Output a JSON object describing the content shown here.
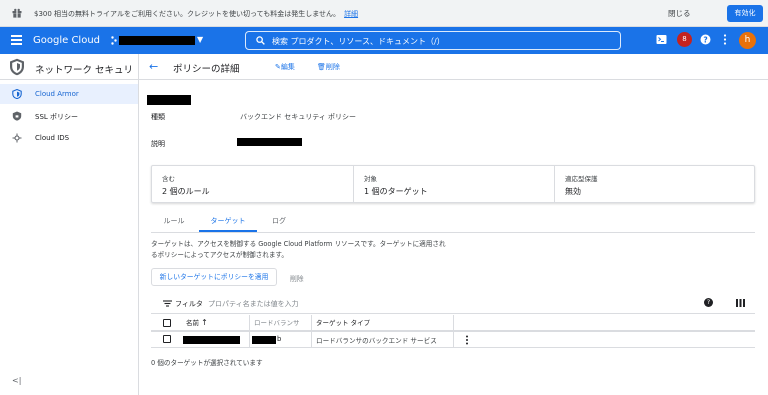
{
  "promo": {
    "text": "$300 相当の無料トライアルをご利用ください。クレジットを使い切っても料金は発生しません。",
    "link": "詳細",
    "dismiss": "閉じる",
    "activate": "有効化"
  },
  "header": {
    "brand": "Google Cloud",
    "search_label": "検索  プロダクト、リソース、ドキュメント（/）",
    "notification_count": "8",
    "avatar_letter": "h"
  },
  "sidebar": {
    "title": "ネットワーク セキュリティ",
    "items": [
      {
        "label": "Cloud Armor",
        "icon": "shield-icon"
      },
      {
        "label": "SSL ポリシー",
        "icon": "ssl-shield-icon"
      },
      {
        "label": "Cloud IDS",
        "icon": "ids-icon"
      }
    ],
    "collapse": "<|"
  },
  "main": {
    "title": "ポリシーの詳細",
    "edit": "編集",
    "delete": "削除",
    "type_key": "種類",
    "type_value": "バックエンド セキュリティ ポリシー",
    "desc_key": "説明",
    "summary": [
      {
        "key": "含む",
        "value": "2 個のルール"
      },
      {
        "key": "対象",
        "value": "1 個のターゲット"
      },
      {
        "key": "適応型保護",
        "value": "無効"
      }
    ],
    "tabs": [
      "ルール",
      "ターゲット",
      "ログ"
    ],
    "targets_desc": "ターゲットは、アクセスを制御する Google Cloud Platform リソースです。ターゲットに適用されるポリシーによってアクセスが制御されます。",
    "apply_button": "新しいターゲットにポリシーを適用",
    "remove_button": "削除",
    "filter_label": "フィルタ",
    "filter_placeholder": "プロパティ名または値を入力",
    "columns": [
      "名前",
      "ロードバランサ",
      "ターゲット タイプ"
    ],
    "rows": [
      {
        "lb_suffix": "b",
        "target_type": "ロードバランサのバックエンド サービス"
      }
    ],
    "selected_text": "0 個のターゲットが選択されています"
  },
  "colors": {
    "accent": "#1a73e8",
    "active_bg": "#e8f0fe",
    "badge": "#c5221f",
    "avatar": "#e8710a"
  }
}
